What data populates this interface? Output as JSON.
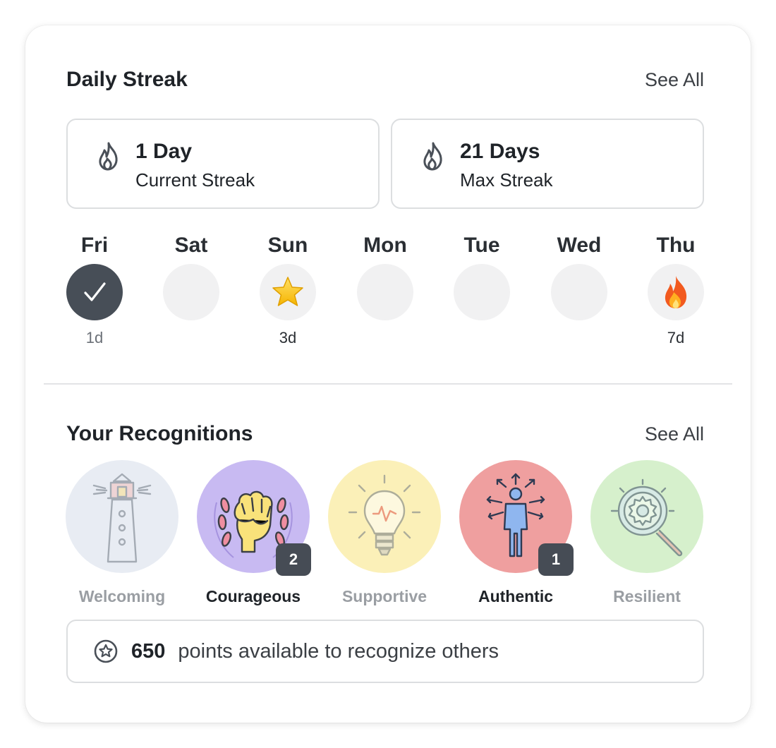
{
  "streak": {
    "title": "Daily Streak",
    "see_all": "See All",
    "current": {
      "value": "1 Day",
      "label": "Current Streak",
      "icon": "flame-icon"
    },
    "max": {
      "value": "21 Days",
      "label": "Max Streak",
      "icon": "flame-icon"
    },
    "days": [
      {
        "name": "Fri",
        "state": "done",
        "icon": "checkmark-icon",
        "count": "1d"
      },
      {
        "name": "Sat",
        "state": "empty",
        "icon": "",
        "count": ""
      },
      {
        "name": "Sun",
        "state": "empty",
        "icon": "star-icon",
        "count": "3d"
      },
      {
        "name": "Mon",
        "state": "empty",
        "icon": "",
        "count": ""
      },
      {
        "name": "Tue",
        "state": "empty",
        "icon": "",
        "count": ""
      },
      {
        "name": "Wed",
        "state": "empty",
        "icon": "",
        "count": ""
      },
      {
        "name": "Thu",
        "state": "empty",
        "icon": "fire-icon",
        "count": "7d"
      }
    ]
  },
  "recognitions": {
    "title": "Your Recognitions",
    "see_all": "See All",
    "items": [
      {
        "label": "Welcoming",
        "icon": "lighthouse-icon",
        "color": "#e7ecf4",
        "badge": "",
        "active": false
      },
      {
        "label": "Courageous",
        "icon": "raised-fist-icon",
        "color": "#c9bbf3",
        "badge": "2",
        "active": true
      },
      {
        "label": "Supportive",
        "icon": "lightbulb-icon",
        "color": "#fbf0b8",
        "badge": "",
        "active": false
      },
      {
        "label": "Authentic",
        "icon": "person-arrows-icon",
        "color": "#ef9f9f",
        "badge": "1",
        "active": true
      },
      {
        "label": "Resilient",
        "icon": "gear-magnifier-icon",
        "color": "#d6f0cc",
        "badge": "",
        "active": false
      }
    ]
  },
  "points": {
    "value": "650",
    "text": "points available to recognize others",
    "icon": "star-circle-icon"
  },
  "colors": {
    "done_circle": "#474e57",
    "empty_circle": "#f1f1f2",
    "badge": "#464c55"
  }
}
